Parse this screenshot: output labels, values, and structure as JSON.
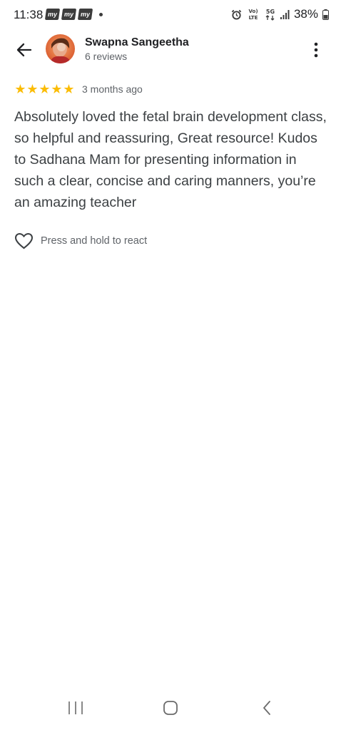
{
  "status_bar": {
    "time": "11:38",
    "notifications": [
      "my",
      "my",
      "my"
    ],
    "network_labels": [
      "Vo) LTE",
      "5G"
    ],
    "battery": "38%"
  },
  "header": {
    "reviewer_name": "Swapna Sangeetha",
    "review_count": "6 reviews"
  },
  "review": {
    "rating": 5,
    "rating_stars": "★★★★★",
    "time_ago": "3 months ago",
    "text": "Absolutely loved the fetal brain development class, so helpful and reassuring, Great resource! Kudos to Sadhana Mam for presenting information in such a clear, concise and caring manners, you’re an amazing teacher"
  },
  "react": {
    "label": "Press and hold to react"
  },
  "colors": {
    "star": "#fbbc04",
    "text_primary": "#202124",
    "text_secondary": "#5f6368"
  }
}
